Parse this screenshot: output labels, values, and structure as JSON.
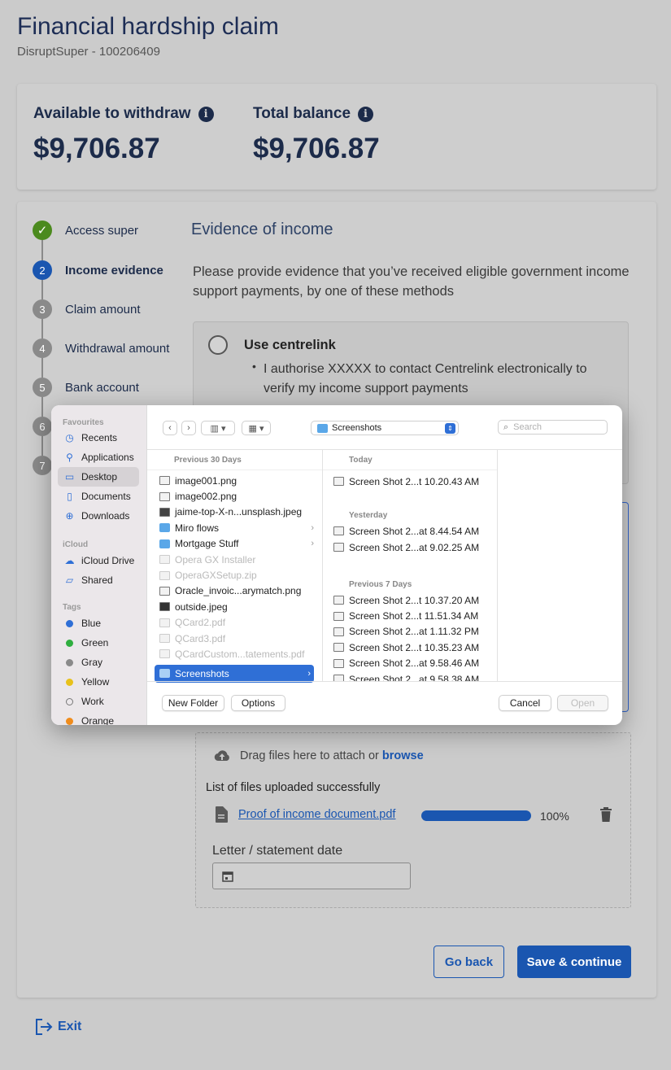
{
  "header": {
    "title": "Financial hardship claim",
    "subtitle": "DisruptSuper - 100206409"
  },
  "balances": {
    "available_label": "Available to withdraw",
    "available_value": "$9,706.87",
    "total_label": "Total balance",
    "total_value": "$9,706.87",
    "info_glyph": "i"
  },
  "steps": [
    {
      "num": "✓",
      "label": "Access super",
      "state": "done"
    },
    {
      "num": "2",
      "label": "Income evidence",
      "state": "active"
    },
    {
      "num": "3",
      "label": "Claim amount",
      "state": "todo"
    },
    {
      "num": "4",
      "label": "Withdrawal amount",
      "state": "todo"
    },
    {
      "num": "5",
      "label": "Bank account",
      "state": "todo"
    },
    {
      "num": "6",
      "label": "",
      "state": "todo"
    },
    {
      "num": "7",
      "label": "",
      "state": "todo"
    }
  ],
  "main": {
    "section_title": "Evidence of income",
    "description": "Please provide evidence that you’ve received eligible government income support payments, by one of these methods",
    "option_title": "Use centrelink",
    "option_bullet": "I authorise XXXXX to contact Centrelink electronically to verify my income support payments"
  },
  "upload": {
    "drag_text": "Drag files here to attach or",
    "browse_link": "browse",
    "list_heading": "List of files uploaded successfully",
    "file_name": "Proof of income document.pdf",
    "progress_text": "100%",
    "progress": 1.0,
    "date_label": "Letter / statement date"
  },
  "actions": {
    "back": "Go back",
    "continue": "Save & continue",
    "exit": "Exit"
  },
  "dialog": {
    "sidebar": {
      "favourites_head": "Favourites",
      "favourites": [
        {
          "label": "Recents",
          "icon": "clock-icon",
          "glyph": "◷"
        },
        {
          "label": "Applications",
          "icon": "applications-icon",
          "glyph": "⚲"
        },
        {
          "label": "Desktop",
          "icon": "desktop-icon",
          "glyph": "▭"
        },
        {
          "label": "Documents",
          "icon": "document-icon",
          "glyph": "▯"
        },
        {
          "label": "Downloads",
          "icon": "download-icon",
          "glyph": "⊕"
        }
      ],
      "icloud_head": "iCloud",
      "icloud": [
        {
          "label": "iCloud Drive",
          "icon": "cloud-icon",
          "glyph": "☁"
        },
        {
          "label": "Shared",
          "icon": "shared-folder-icon",
          "glyph": "▱"
        }
      ],
      "tags_head": "Tags",
      "tags": [
        {
          "label": "Blue",
          "color": "#2f6fd6"
        },
        {
          "label": "Green",
          "color": "#2fae3f"
        },
        {
          "label": "Gray",
          "color": "#8a8a8a"
        },
        {
          "label": "Yellow",
          "color": "#e8c11b"
        },
        {
          "label": "Work",
          "color": "none"
        },
        {
          "label": "Orange",
          "color": "#f08c1c"
        }
      ]
    },
    "location": "Screenshots",
    "search_placeholder": "Search",
    "col1_head": "Previous 30 Days",
    "col1": [
      {
        "name": "image001.png",
        "kind": "file",
        "dim": false
      },
      {
        "name": "image002.png",
        "kind": "file",
        "dim": false
      },
      {
        "name": "jaime-top-X-n...unsplash.jpeg",
        "kind": "file",
        "dim": false
      },
      {
        "name": "Miro flows",
        "kind": "folder",
        "dim": false
      },
      {
        "name": "Mortgage Stuff",
        "kind": "folder",
        "dim": false
      },
      {
        "name": "Opera GX Installer",
        "kind": "file",
        "dim": true
      },
      {
        "name": "OperaGXSetup.zip",
        "kind": "file",
        "dim": true
      },
      {
        "name": "Oracle_invoic...arymatch.png",
        "kind": "file",
        "dim": false
      },
      {
        "name": "outside.jpeg",
        "kind": "file",
        "dim": false
      },
      {
        "name": "QCard2.pdf",
        "kind": "file",
        "dim": true
      },
      {
        "name": "QCard3.pdf",
        "kind": "file",
        "dim": true
      },
      {
        "name": "QCardCustom...tatements.pdf",
        "kind": "file",
        "dim": true
      },
      {
        "name": "Screenshots",
        "kind": "folder",
        "dim": false
      }
    ],
    "col2_today_head": "Today",
    "col2_today": [
      "Screen Shot 2...t 10.20.43 AM"
    ],
    "col2_yesterday_head": "Yesterday",
    "col2_yesterday": [
      "Screen Shot 2...at 8.44.54 AM",
      "Screen Shot 2...at 9.02.25 AM"
    ],
    "col2_week_head": "Previous 7 Days",
    "col2_week": [
      "Screen Shot 2...t 10.37.20 AM",
      "Screen Shot 2...t 11.51.34 AM",
      "Screen Shot 2...at 1.11.32 PM",
      "Screen Shot 2...t 10.35.23 AM",
      "Screen Shot 2...at 9.58.46 AM",
      "Screen Shot 2...at 9.58.38 AM"
    ],
    "buttons": {
      "new_folder": "New Folder",
      "options": "Options",
      "cancel": "Cancel",
      "open": "Open"
    }
  },
  "colors": {
    "primary": "#1a56b0",
    "navy": "#1c2b4a",
    "success": "#4b8a1e",
    "selection": "#2f6fd6"
  }
}
